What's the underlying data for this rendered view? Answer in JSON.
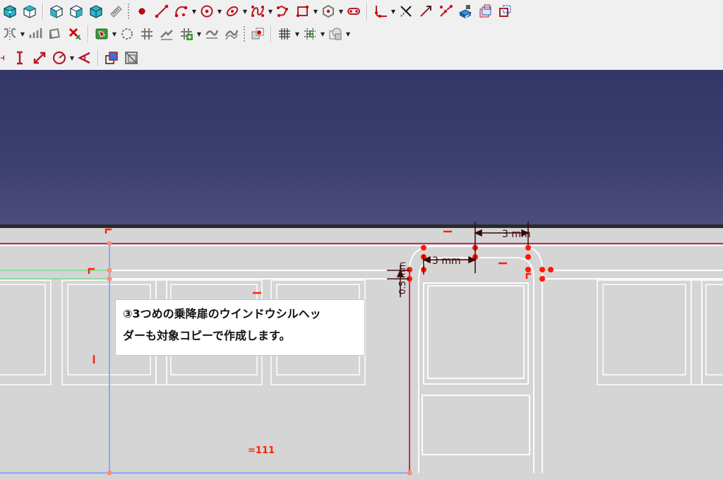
{
  "toolbars": {
    "row1_icons": [
      "view-fit-all-icon",
      "view-isometric-icon",
      "view-front-icon",
      "view-top-icon",
      "view-right-icon",
      "measure-icon",
      "sketch-point-icon",
      "sketch-line-icon",
      "sketch-arc-icon",
      "sketch-circle-icon",
      "sketch-conic-icon",
      "sketch-bspline-icon",
      "sketch-polyline-icon",
      "sketch-rectangle-icon",
      "sketch-polygon-icon",
      "sketch-slot-icon",
      "sketch-fillet-icon",
      "sketch-trim-icon",
      "sketch-extend-icon",
      "sketch-split-icon",
      "sketch-external-geometry-icon",
      "sketch-carbon-copy-icon",
      "sketch-construction-mode-icon"
    ],
    "row2_icons": [
      "sketch-symmetry-icon",
      "sketch-array-icon",
      "sketch-clone-icon",
      "sketch-delete-constraints-icon",
      "sketch-select-icon",
      "sketch-show-hide-icon",
      "constrain-coincident-icon",
      "constrain-lock-icon",
      "constrain-tangent-icon",
      "constrain-equal-icon",
      "sketch-bspline-tools-icon",
      "sketch-grid-icon",
      "sketch-snap-icon",
      "sketch-render-order-icon"
    ],
    "row3_icons": [
      "constrain-horizontal-distance-icon",
      "constrain-vertical-distance-icon",
      "constrain-distance-icon",
      "constrain-radius-icon",
      "constrain-angle-icon",
      "toggle-driving-icon",
      "toggle-active-icon"
    ]
  },
  "dimensions": {
    "top_width": "3 mm",
    "inner_width": "3 mm",
    "vertical": "0.5 mm"
  },
  "constraint_labels": {
    "equal_label": "=111"
  },
  "annotation": {
    "line1": "③3つめの乗降扉のウインドウシルヘッ",
    "line2": "ダーも対象コピーで作成します。"
  },
  "colors": {
    "sky_top": "#333666",
    "sky_bottom": "#4d4d7c",
    "sketch_bg": "#d5d5d5",
    "geometry": "#ffffff",
    "constraint": "#ff2200",
    "crimson_line": "#d0245c",
    "blue_line": "#8aa8ff",
    "green_line": "#8fdca0",
    "dimension": "#3a0808"
  }
}
